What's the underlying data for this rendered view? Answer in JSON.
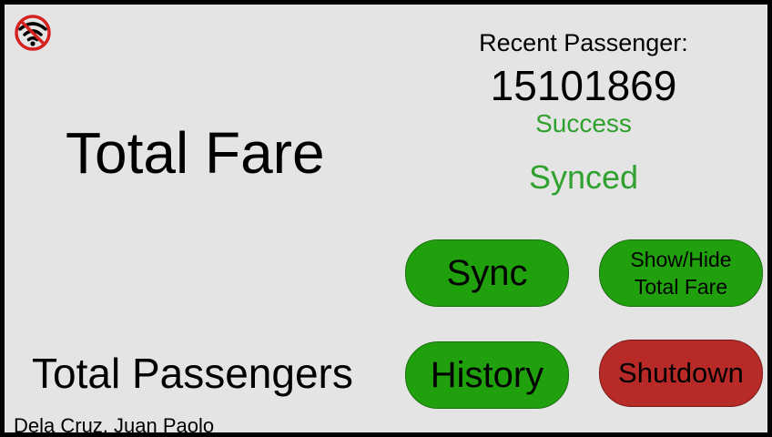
{
  "status_bar": {
    "wifi_icon": "wifi-off-icon",
    "icon_color": "#d62121"
  },
  "main": {
    "total_fare_label": "Total Fare",
    "total_passengers_label": "Total Passengers",
    "author": "Dela Cruz, Juan Paolo"
  },
  "recent_passenger": {
    "heading": "Recent Passenger:",
    "id": "15101869",
    "scan_status": "Success",
    "sync_status": "Synced"
  },
  "buttons": {
    "sync_label": "Sync",
    "toggle_fare_label": "Show/Hide\nTotal Fare",
    "history_label": "History",
    "shutdown_label": "Shutdown"
  },
  "colors": {
    "background": "#e4e4e4",
    "button_green": "#21a00e",
    "button_red": "#b82a27",
    "status_green": "#2ea12e"
  }
}
